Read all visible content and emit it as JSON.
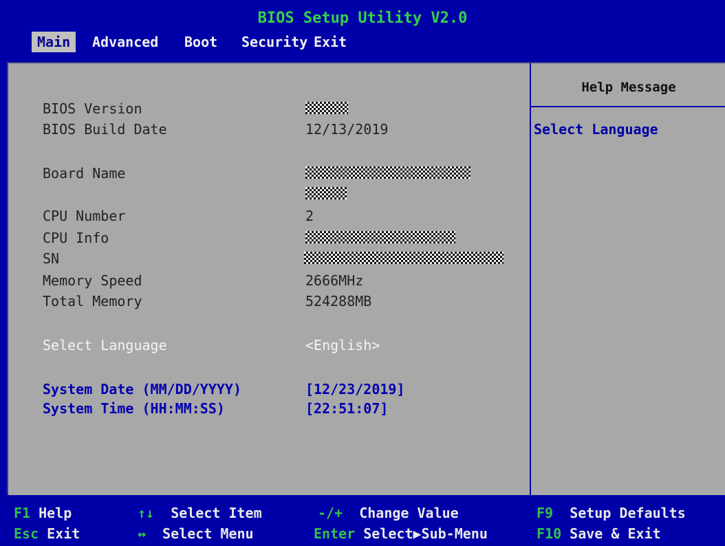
{
  "header": {
    "title": "BIOS Setup Utility V2.0",
    "menu": [
      "Main",
      "Advanced",
      "Boot",
      "Security",
      "Exit"
    ],
    "active_menu": "Main"
  },
  "main": {
    "bios_version_label": "BIOS Version",
    "bios_build_date_label": "BIOS Build Date",
    "bios_build_date_value": "12/13/2019",
    "board_name_label": "Board Name",
    "cpu_number_label": "CPU Number",
    "cpu_number_value": "2",
    "cpu_info_label": "CPU Info",
    "sn_label": "SN",
    "memory_speed_label": "Memory Speed",
    "memory_speed_value": "2666MHz",
    "total_memory_label": "Total Memory",
    "total_memory_value": "524288MB",
    "select_language_label": "Select Language",
    "select_language_value": "<English>",
    "system_date_label": "System Date (MM/DD/YYYY)",
    "system_date_value": "[12/23/2019]",
    "system_time_label": "System Time (HH:MM:SS)",
    "system_time_value": "[22:51:07]"
  },
  "help": {
    "title": "Help Message",
    "text": "Select Language"
  },
  "footer": {
    "f1_key": "F1",
    "f1_desc": "Help",
    "arrows_ud_key": "↑↓",
    "arrows_ud_desc": "Select Item",
    "pm_key": "-/+",
    "pm_desc": "Change Value",
    "f9_key": "F9",
    "f9_desc": "Setup Defaults",
    "esc_key": "Esc",
    "esc_desc": "Exit",
    "arrows_lr_key": "↔",
    "arrows_lr_desc": "Select Menu",
    "enter_key": "Enter",
    "enter_desc": "Select▶Sub-Menu",
    "f10_key": "F10",
    "f10_desc": "Save & Exit"
  },
  "colors": {
    "background": "#0000a8",
    "panel": "#a8a8a8",
    "title": "#34d24a",
    "highlight": "#0000b0"
  }
}
